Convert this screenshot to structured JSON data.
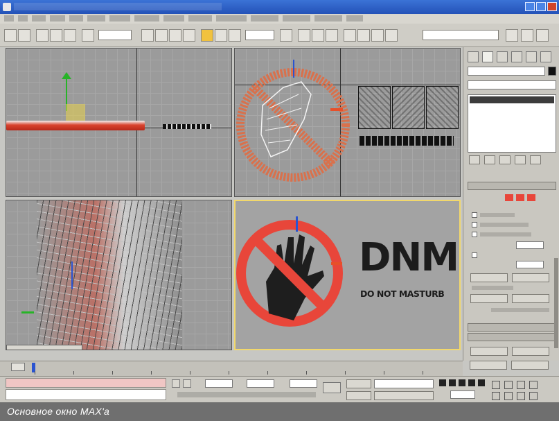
{
  "caption": {
    "text": "Основное окно MAX'a"
  },
  "viewport_text": {
    "dnm": "DNM",
    "tagline": "DO NOT MASTURB"
  },
  "icons": {
    "app": "app-icon",
    "minimize": "minimize-icon",
    "maximize": "maximize-icon",
    "close": "close-icon",
    "undo": "undo-icon",
    "redo": "redo-icon",
    "select": "select-icon",
    "move": "move-icon",
    "rotate": "rotate-icon",
    "scale": "scale-icon",
    "create": "create-panel-icon",
    "modify": "modify-panel-icon",
    "hierarchy": "hierarchy-panel-icon",
    "motion": "motion-panel-icon",
    "display": "display-panel-icon",
    "utilities": "utilities-panel-icon",
    "play": "play-icon",
    "key": "key-icon",
    "lock": "lock-icon",
    "zoom": "zoom-icon",
    "pan": "pan-icon",
    "orbit": "orbit-icon"
  },
  "colors": {
    "active_viewport_border": "#f2d86b",
    "sign_red": "#e8463a",
    "viewport_bg": "#9b9b9b",
    "titlebar": "#2452b8"
  }
}
